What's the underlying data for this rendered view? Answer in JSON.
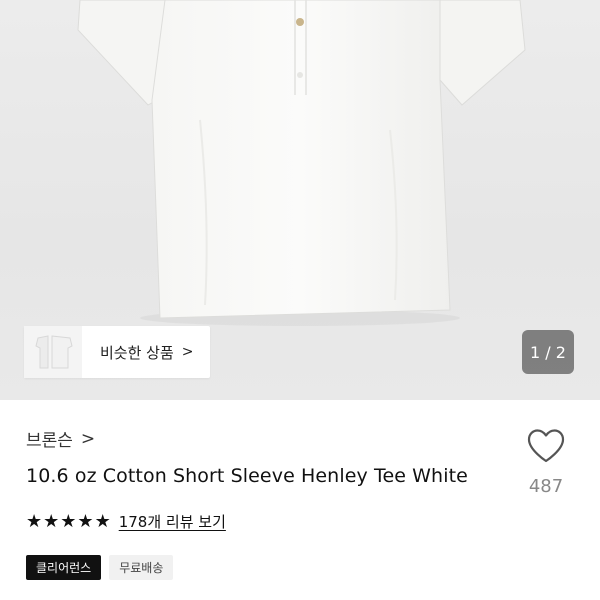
{
  "similar": {
    "label": "비슷한 상품",
    "chevron": ">"
  },
  "pager": {
    "text": "1 / 2"
  },
  "product": {
    "brand": "브론슨",
    "brand_chevron": ">",
    "title": "10.6 oz Cotton Short Sleeve Henley Tee White",
    "rating_stars": 5,
    "review_link": "178개 리뷰 보기",
    "badges": [
      "클리어런스",
      "무료배송"
    ],
    "wish_count": "487"
  },
  "icons": {
    "heart": "heart-icon",
    "star": "star-icon",
    "chevron": "chevron-right-icon"
  },
  "colors": {
    "badge_dark": "#111111",
    "badge_light": "#f1f1f1",
    "pager_bg": "#5a5a5a"
  }
}
